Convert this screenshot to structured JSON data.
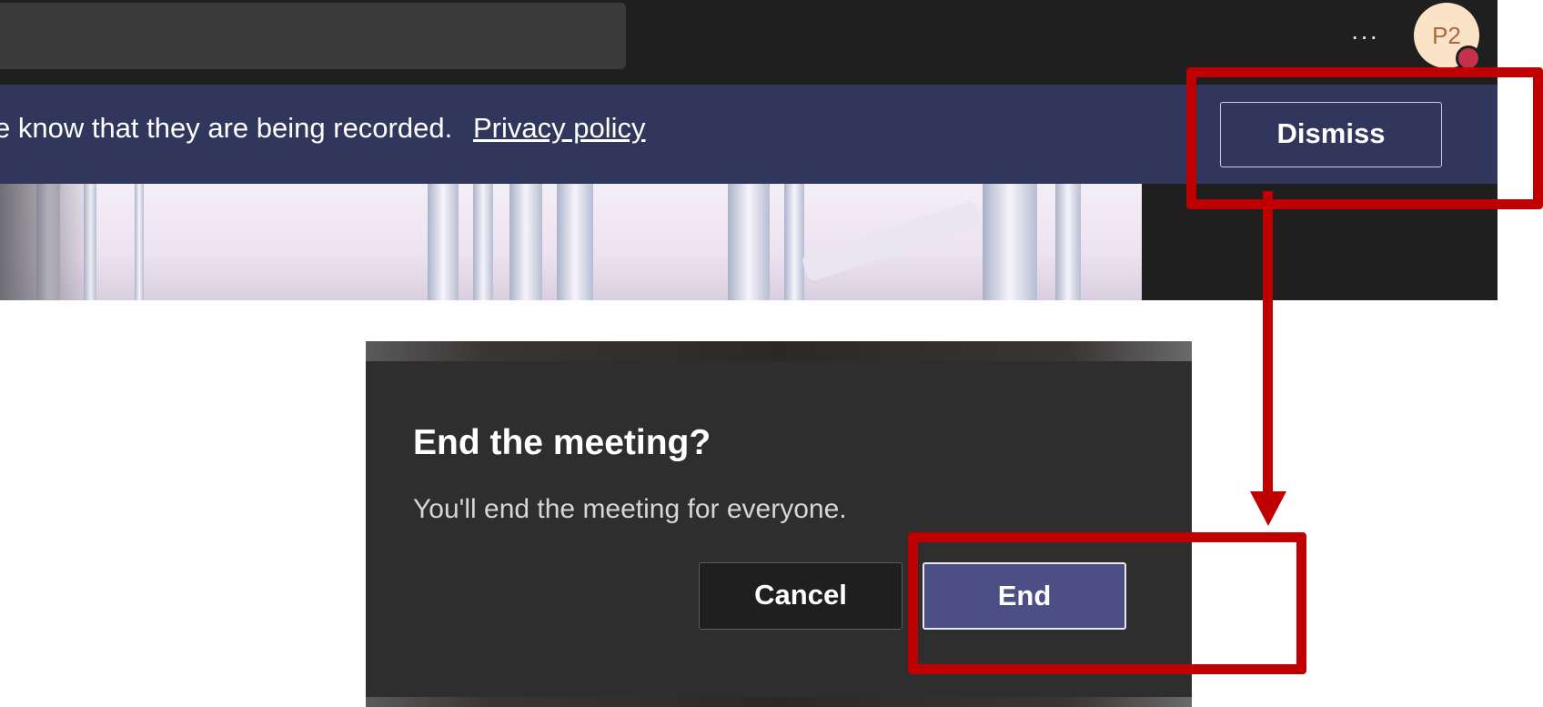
{
  "topbar": {
    "more_icon": "more-horizontal-icon",
    "more_glyph": "···",
    "avatar_initials": "P2",
    "presence_status": "busy",
    "colors": {
      "background": "#1f1f1f",
      "search_box": "#3a3a3a",
      "avatar_bg": "#fbe3c8",
      "presence": "#c4314b"
    }
  },
  "banner": {
    "message": "e know that they are being recorded.",
    "link_text": "Privacy policy",
    "dismiss_label": "Dismiss",
    "color": "#31375c"
  },
  "dialog": {
    "title": "End the meeting?",
    "body": "You'll end the meeting for everyone.",
    "cancel_label": "Cancel",
    "end_label": "End",
    "colors": {
      "background": "#2e2e2e",
      "primary_button": "#4b4f86"
    }
  },
  "annotations": {
    "highlight_color": "#c00000",
    "arrow_from": "dismiss-button",
    "arrow_to": "end-button"
  }
}
